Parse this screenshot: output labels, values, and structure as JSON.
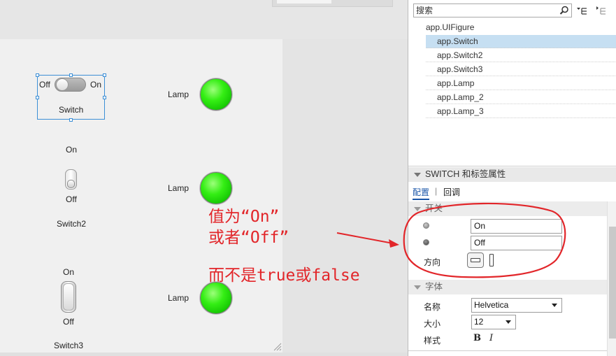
{
  "canvas": {
    "switch1": {
      "off_label": "Off",
      "on_label": "On",
      "name": "Switch"
    },
    "switch2": {
      "on_label": "On",
      "off_label": "Off",
      "name": "Switch2"
    },
    "switch3": {
      "on_label": "On",
      "off_label": "Off",
      "name": "Switch3"
    },
    "lamps": [
      {
        "label": "Lamp",
        "color": "#22e60a"
      },
      {
        "label": "Lamp",
        "color": "#22e60a"
      },
      {
        "label": "Lamp",
        "color": "#22e60a"
      }
    ]
  },
  "annotation": {
    "line1": "值为“On”",
    "line2": "或者“Off”",
    "line3": "而不是true或false",
    "color": "#e2262a"
  },
  "panel": {
    "search": {
      "placeholder": "搜索"
    },
    "toolbar": {
      "icons": [
        "search-icon",
        "collapse-tree-icon",
        "expand-tree-icon"
      ]
    },
    "tree": {
      "root": "app.UIFigure",
      "items": [
        "app.Switch",
        "app.Switch2",
        "app.Switch3",
        "app.Lamp",
        "app.Lamp_2",
        "app.Lamp_3"
      ],
      "selected": "app.Switch"
    },
    "props_header": "SWITCH 和标签属性",
    "tabs": [
      "配置",
      "回调"
    ],
    "active_tab": "配置",
    "switch_section": {
      "title": "开关",
      "items": [
        "On",
        "Off"
      ],
      "orientation_label": "方向"
    },
    "font_section": {
      "title": "字体",
      "name_label": "名称",
      "name_value": "Helvetica",
      "size_label": "大小",
      "size_value": "12",
      "style_label": "样式",
      "bold": "B",
      "italic": "I"
    }
  }
}
